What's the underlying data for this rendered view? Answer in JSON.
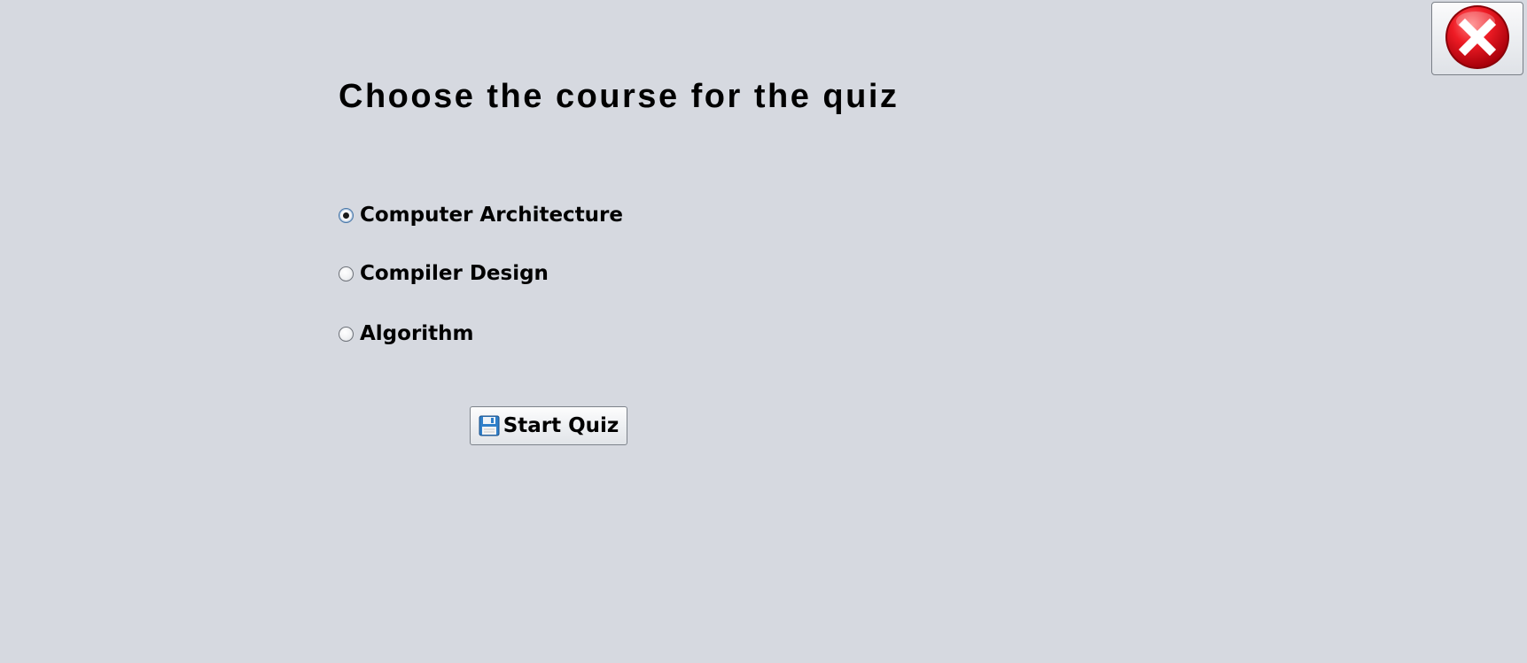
{
  "window": {
    "title": "Choose the course for the quiz",
    "close_icon": "close-icon"
  },
  "course_selection": {
    "selected": "Computer Architecture",
    "options": [
      {
        "label": "Computer Architecture",
        "checked": true
      },
      {
        "label": "Compiler Design",
        "checked": false
      },
      {
        "label": "Algorithm",
        "checked": false
      }
    ]
  },
  "actions": {
    "start_label": "Start Quiz",
    "start_icon": "floppy-disk-icon"
  },
  "colors": {
    "background": "#d6d9e0",
    "close_red": "#e8101c",
    "floppy_blue": "#2f7fc9"
  }
}
